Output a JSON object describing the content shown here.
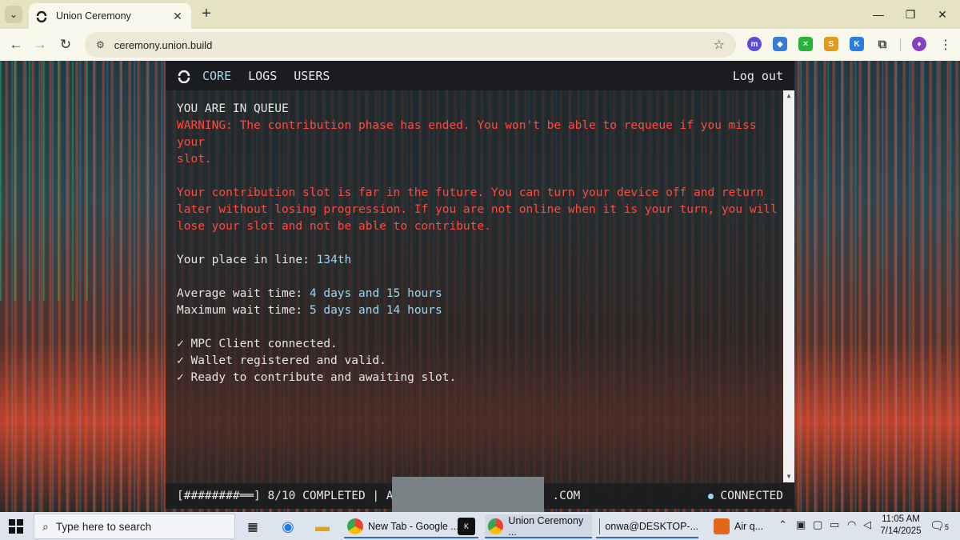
{
  "browser": {
    "tab_title": "Union Ceremony",
    "url": "ceremony.union.build",
    "close_glyph": "✕",
    "new_tab_glyph": "+",
    "window_controls": {
      "minimize": "—",
      "restore": "❐",
      "close": "✕"
    },
    "extensions": [
      {
        "name": "m-extension-icon",
        "label": "m",
        "color": "#5b4bd6"
      },
      {
        "name": "wallet-extension-icon",
        "label": "◆",
        "color": "#3a7bd5"
      },
      {
        "name": "green-extension-icon",
        "label": "✕",
        "color": "#27b33b"
      },
      {
        "name": "orange-extension-icon",
        "label": "S",
        "color": "#e39a1a"
      },
      {
        "name": "k-extension-icon",
        "label": "K",
        "color": "#2a7de1"
      },
      {
        "name": "puzzle-extension-icon",
        "label": "⧉",
        "color": "#555555"
      },
      {
        "name": "profile-extension-icon",
        "label": "♦",
        "color": "#8a3fbf"
      }
    ]
  },
  "terminal": {
    "nav": {
      "core": "CORE",
      "logs": "LOGS",
      "users": "USERS",
      "logout": "Log out"
    },
    "queue_title": "YOU ARE IN QUEUE",
    "warning_line1": "WARNING: The contribution phase has ended. You won't be able to requeue if you miss your",
    "warning_line2": "slot.",
    "info_line1": "Your contribution slot is far in the future. You can turn your device off and return",
    "info_line2": "later without losing progression. If you are not online when it is your turn, you will",
    "info_line3": "lose your slot and not be able to contribute.",
    "place_label": "Your place in line: ",
    "place_value": "134th",
    "avg_label": "Average wait time: ",
    "avg_value": "4 days and 15 hours",
    "max_label": "Maximum wait time: ",
    "max_value": "5 days and 14 hours",
    "checks": [
      "✓ MPC Client connected.",
      "✓ Wallet registered and valid.",
      "✓ Ready to contribute and awaiting slot."
    ],
    "status": {
      "progress": "[########══] 8/10 COMPLETED | AR",
      "suffix": ".COM",
      "connection": "CONNECTED"
    }
  },
  "taskbar": {
    "search_placeholder": "Type here to search",
    "apps": [
      {
        "label": "New Tab - Google ..."
      },
      {
        "label": "Union Ceremony ..."
      },
      {
        "label": "onwa@DESKTOP-..."
      },
      {
        "label": "Air q..."
      }
    ],
    "time": "11:05 AM",
    "date": "7/14/2025",
    "notification_count": "5"
  },
  "colors": {
    "accent": "#a8d8ee",
    "warning": "#ff4a3d",
    "terminal_bg": "#1e2224"
  }
}
